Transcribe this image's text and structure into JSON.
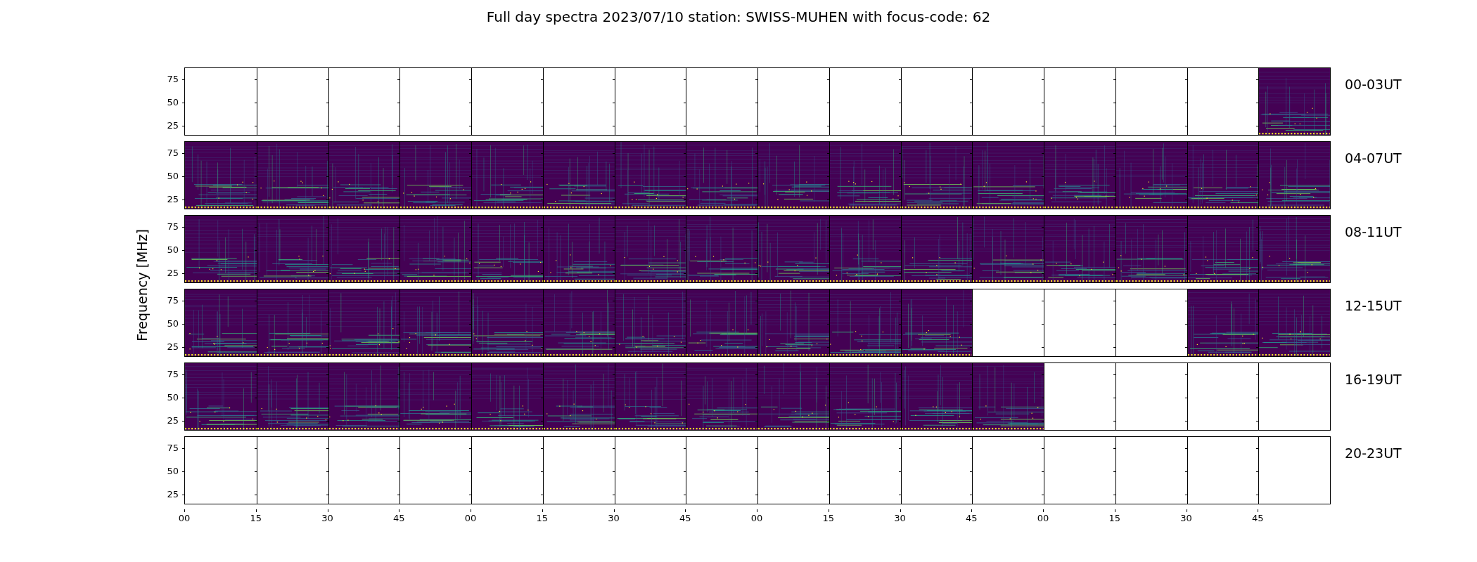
{
  "title": "Full day spectra 2023/07/10 station: SWISS-MUHEN with focus-code: 62",
  "y_axis_label": "Frequency [MHz]",
  "rows": [
    {
      "label": "00-03UT",
      "y_ticks": [
        "75",
        "50",
        "25"
      ],
      "panels": [
        {
          "has_data": false
        },
        {
          "has_data": false
        },
        {
          "has_data": false
        },
        {
          "has_data": false
        },
        {
          "has_data": false
        },
        {
          "has_data": false
        },
        {
          "has_data": false
        },
        {
          "has_data": false
        },
        {
          "has_data": false
        },
        {
          "has_data": false
        },
        {
          "has_data": false
        },
        {
          "has_data": false
        },
        {
          "has_data": false
        },
        {
          "has_data": false
        },
        {
          "has_data": false
        },
        {
          "has_data": true
        }
      ]
    },
    {
      "label": "04-07UT",
      "y_ticks": [
        "75",
        "50",
        "25"
      ],
      "panels": [
        {
          "has_data": true
        },
        {
          "has_data": true
        },
        {
          "has_data": true
        },
        {
          "has_data": true
        },
        {
          "has_data": true
        },
        {
          "has_data": true
        },
        {
          "has_data": true
        },
        {
          "has_data": true
        },
        {
          "has_data": true
        },
        {
          "has_data": true
        },
        {
          "has_data": true
        },
        {
          "has_data": true
        },
        {
          "has_data": true
        },
        {
          "has_data": true
        },
        {
          "has_data": true
        },
        {
          "has_data": true
        }
      ]
    },
    {
      "label": "08-11UT",
      "y_ticks": [
        "75",
        "50",
        "25"
      ],
      "panels": [
        {
          "has_data": true
        },
        {
          "has_data": true
        },
        {
          "has_data": true
        },
        {
          "has_data": true
        },
        {
          "has_data": true
        },
        {
          "has_data": true
        },
        {
          "has_data": true
        },
        {
          "has_data": true
        },
        {
          "has_data": true
        },
        {
          "has_data": true
        },
        {
          "has_data": true
        },
        {
          "has_data": true
        },
        {
          "has_data": true
        },
        {
          "has_data": true
        },
        {
          "has_data": true
        },
        {
          "has_data": true
        }
      ]
    },
    {
      "label": "12-15UT",
      "y_ticks": [
        "75",
        "50",
        "25"
      ],
      "panels": [
        {
          "has_data": true
        },
        {
          "has_data": true
        },
        {
          "has_data": true
        },
        {
          "has_data": true
        },
        {
          "has_data": true
        },
        {
          "has_data": true
        },
        {
          "has_data": true
        },
        {
          "has_data": true
        },
        {
          "has_data": true
        },
        {
          "has_data": true
        },
        {
          "has_data": true
        },
        {
          "has_data": false
        },
        {
          "has_data": false
        },
        {
          "has_data": false
        },
        {
          "has_data": true
        },
        {
          "has_data": true
        }
      ]
    },
    {
      "label": "16-19UT",
      "y_ticks": [
        "75",
        "50",
        "25"
      ],
      "panels": [
        {
          "has_data": true
        },
        {
          "has_data": true
        },
        {
          "has_data": true
        },
        {
          "has_data": true
        },
        {
          "has_data": true
        },
        {
          "has_data": true
        },
        {
          "has_data": true
        },
        {
          "has_data": true
        },
        {
          "has_data": true
        },
        {
          "has_data": true
        },
        {
          "has_data": true
        },
        {
          "has_data": true
        },
        {
          "has_data": false
        },
        {
          "has_data": false
        },
        {
          "has_data": false
        },
        {
          "has_data": false
        }
      ]
    },
    {
      "label": "20-23UT",
      "y_ticks": [
        "75",
        "50",
        "25"
      ],
      "panels": [
        {
          "has_data": false
        },
        {
          "has_data": false
        },
        {
          "has_data": false
        },
        {
          "has_data": false
        },
        {
          "has_data": false
        },
        {
          "has_data": false
        },
        {
          "has_data": false
        },
        {
          "has_data": false
        },
        {
          "has_data": false
        },
        {
          "has_data": false
        },
        {
          "has_data": false
        },
        {
          "has_data": false
        },
        {
          "has_data": false
        },
        {
          "has_data": false
        },
        {
          "has_data": false
        },
        {
          "has_data": false
        }
      ]
    }
  ],
  "x_ticks": [
    "00",
    "15",
    "30",
    "45",
    "00",
    "15",
    "30",
    "45",
    "00",
    "15",
    "30",
    "45",
    "00",
    "15",
    "30",
    "45"
  ]
}
